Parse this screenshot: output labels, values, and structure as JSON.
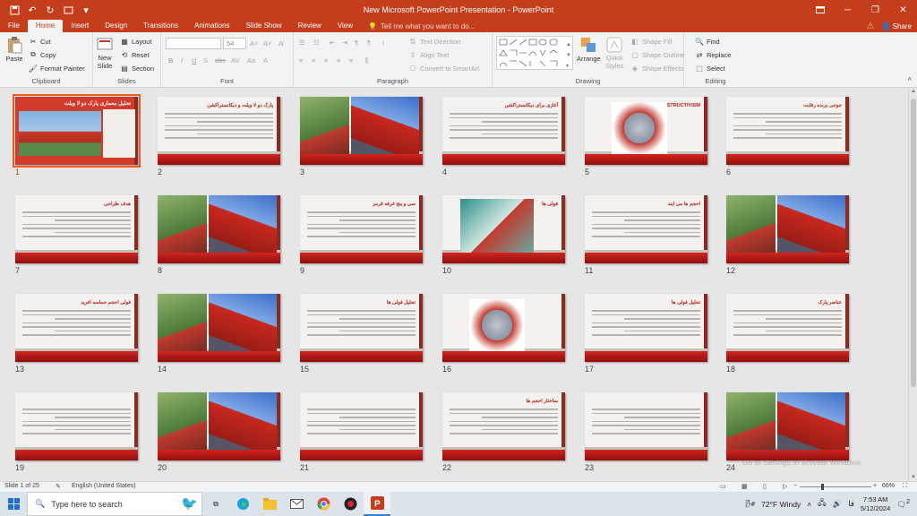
{
  "titlebar": {
    "title": "New Microsoft PowerPoint Presentation - PowerPoint",
    "qat": [
      "save-icon",
      "undo-icon",
      "redo-icon",
      "customize-icon"
    ]
  },
  "tabs": [
    "File",
    "Home",
    "Insert",
    "Design",
    "Transitions",
    "Animations",
    "Slide Show",
    "Review",
    "View"
  ],
  "active_tab": "Home",
  "tell_me": "Tell me what you want to do...",
  "share": "Share",
  "ribbon": {
    "clipboard": {
      "label": "Clipboard",
      "paste": "Paste",
      "cut": "Cut",
      "copy": "Copy",
      "format_painter": "Format Painter"
    },
    "slides": {
      "label": "Slides",
      "new_slide": "New",
      "new_slide2": "Slide",
      "layout": "Layout",
      "reset": "Reset",
      "section": "Section"
    },
    "font": {
      "label": "Font",
      "size": "54"
    },
    "paragraph": {
      "label": "Paragraph",
      "text_direction": "Text Direction",
      "align_text": "Align Text",
      "convert_smartart": "Convert to SmartArt"
    },
    "drawing": {
      "label": "Drawing",
      "arrange": "Arrange",
      "quick_styles": "Quick",
      "quick_styles2": "Styles",
      "shape_fill": "Shape Fill",
      "shape_outline": "Shape Outline",
      "shape_effects": "Shape Effects"
    },
    "editing": {
      "label": "Editing",
      "find": "Find",
      "replace": "Replace",
      "select": "Select"
    }
  },
  "slides": [
    {
      "n": "1",
      "title": "تحلیل معماری پارک دو لا ویلت",
      "kind": "cover"
    },
    {
      "n": "2",
      "title": "پارک دو لا ویلت و دیکانستراکشن",
      "kind": "text"
    },
    {
      "n": "3",
      "title": "",
      "kind": "photos"
    },
    {
      "n": "4",
      "title": "آغازی برای دیکانستراکشن",
      "kind": "text"
    },
    {
      "n": "5",
      "title": "DECONSTRUCTIVISM",
      "kind": "photo-center"
    },
    {
      "n": "6",
      "title": "جوجی برنده رقابت",
      "kind": "text"
    },
    {
      "n": "7",
      "title": "هدف طراحی",
      "kind": "text"
    },
    {
      "n": "8",
      "title": "",
      "kind": "photos"
    },
    {
      "n": "9",
      "title": "سی و پنج غرفه قرمز",
      "kind": "text"
    },
    {
      "n": "10",
      "title": "فولی ها",
      "kind": "photo-left"
    },
    {
      "n": "11",
      "title": "احجم ها می ایند",
      "kind": "text"
    },
    {
      "n": "12",
      "title": "",
      "kind": "photos"
    },
    {
      "n": "13",
      "title": "فولی احجم حماسه افرید",
      "kind": "text"
    },
    {
      "n": "14",
      "title": "",
      "kind": "photos-small"
    },
    {
      "n": "15",
      "title": "تحلیل فولی ها",
      "kind": "text"
    },
    {
      "n": "16",
      "title": "",
      "kind": "photo-center"
    },
    {
      "n": "17",
      "title": "تحلیل فولی ها",
      "kind": "text"
    },
    {
      "n": "18",
      "title": "عناصر پارک",
      "kind": "text"
    },
    {
      "n": "19",
      "title": "",
      "kind": "text"
    },
    {
      "n": "20",
      "title": "",
      "kind": "photos"
    },
    {
      "n": "21",
      "title": "",
      "kind": "text"
    },
    {
      "n": "22",
      "title": "ساختار احجم ها",
      "kind": "text"
    },
    {
      "n": "23",
      "title": "",
      "kind": "text"
    },
    {
      "n": "24",
      "title": "",
      "kind": "photos"
    }
  ],
  "watermark": {
    "line1": "Activate Windows",
    "line2": "Go to Settings to activate Windows."
  },
  "statusbar": {
    "slide_info": "Slide 1 of 25",
    "language": "English (United States)",
    "zoom": "66%"
  },
  "taskbar": {
    "search_placeholder": "Type here to search",
    "weather": "72°F  Windy",
    "lang": "فا",
    "time": "7:53 AM",
    "date": "5/12/2024",
    "notifications": "2"
  },
  "colors": {
    "accent": "#c43e1c",
    "slide_red": "#c0201b",
    "selection": "#e65c26"
  }
}
